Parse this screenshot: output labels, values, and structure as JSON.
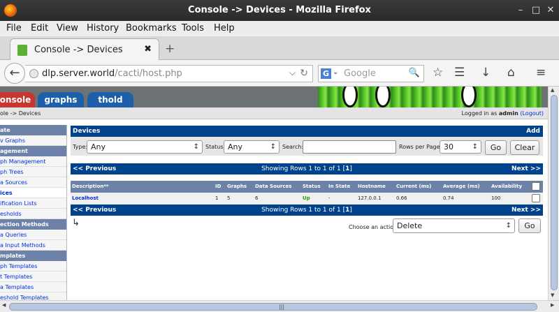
{
  "window": {
    "title": "Console -> Devices - Mozilla Firefox",
    "minimize": "–",
    "maximize": "□",
    "close": "✕"
  },
  "menu": [
    "File",
    "Edit",
    "View",
    "History",
    "Bookmarks",
    "Tools",
    "Help"
  ],
  "tab": {
    "title": "Console -> Devices",
    "close": "✖",
    "new_tab": "+"
  },
  "nav": {
    "url_host": "dlp.server.world",
    "url_path": "/cacti/host.php",
    "search_placeholder": "Google",
    "search_engine": "G"
  },
  "cacti": {
    "tabs": [
      "onsole",
      "graphs",
      "thold"
    ],
    "breadcrumb": "ole -> Devices",
    "logged_prefix": "Logged in as",
    "user": "admin",
    "logout": "(Logout)"
  },
  "sidebar": [
    {
      "text": "ate",
      "type": "header"
    },
    {
      "text": "v Graphs",
      "type": "item"
    },
    {
      "text": "agement",
      "type": "header"
    },
    {
      "text": "ph Management",
      "type": "item"
    },
    {
      "text": "ph Trees",
      "type": "item"
    },
    {
      "text": "a Sources",
      "type": "item"
    },
    {
      "text": "ices",
      "type": "item",
      "selected": true
    },
    {
      "text": "ification Lists",
      "type": "item"
    },
    {
      "text": "esholds",
      "type": "item"
    },
    {
      "text": "ection Methods",
      "type": "header"
    },
    {
      "text": "a Queries",
      "type": "item"
    },
    {
      "text": "a Input Methods",
      "type": "item"
    },
    {
      "text": "mplates",
      "type": "header"
    },
    {
      "text": "ph Templates",
      "type": "item"
    },
    {
      "text": "t Templates",
      "type": "item"
    },
    {
      "text": "a Templates",
      "type": "item"
    },
    {
      "text": "eshold Templates",
      "type": "item"
    }
  ],
  "devices": {
    "title": "Devices",
    "add": "Add",
    "filter": {
      "type_label": "Type:",
      "type_value": "Any",
      "status_label": "Status:",
      "status_value": "Any",
      "search_label": "Search:",
      "search_value": "",
      "rows_label": "Rows per Page:",
      "rows_value": "30",
      "go": "Go",
      "clear": "Clear"
    },
    "nav": {
      "prev": "<< Previous",
      "next": "Next >>",
      "showing": "Showing Rows 1 to 1 of 1 [",
      "page": "1",
      "close_bracket": "]"
    },
    "columns": [
      "Description**",
      "ID",
      "Graphs",
      "Data Sources",
      "Status",
      "In State",
      "Hostname",
      "Current (ms)",
      "Average (ms)",
      "Availability"
    ],
    "rows": [
      {
        "description": "Localhost",
        "id": "1",
        "graphs": "5",
        "data_sources": "6",
        "status": "Up",
        "in_state": "-",
        "hostname": "127.0.0.1",
        "current": "0.66",
        "average": "0.74",
        "availability": "100"
      }
    ],
    "action_label": "Choose an action:",
    "action_value": "Delete",
    "action_go": "Go",
    "arrow": "↳"
  },
  "colors": {
    "blue_bar": "#00438c",
    "header": "#6d82a8",
    "status_up": "#2e9a00",
    "link": "#002ee0"
  }
}
